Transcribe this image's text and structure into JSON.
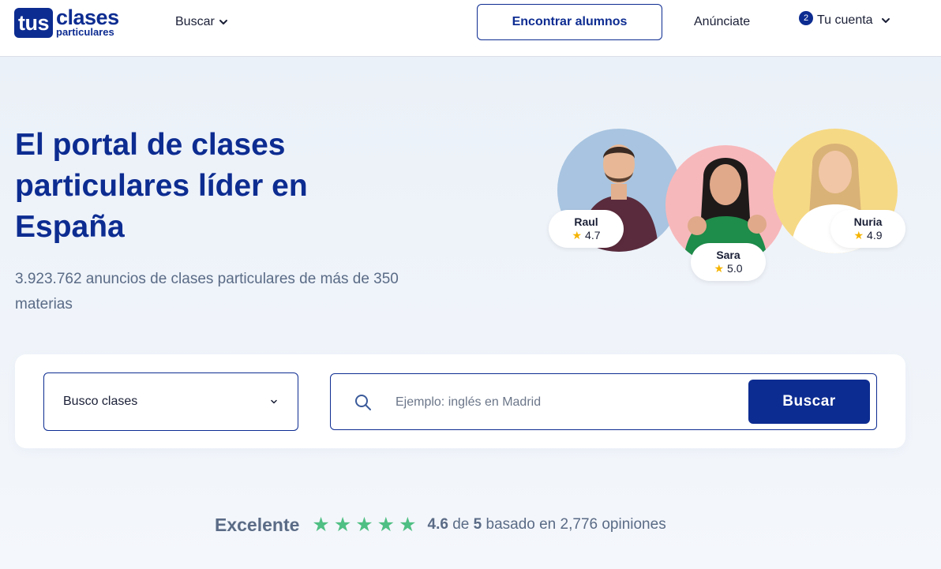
{
  "brand": {
    "logo_tus": "tus",
    "logo_clases": "clases",
    "logo_particulares": "particulares"
  },
  "nav": {
    "buscar_label": "Buscar",
    "encontrar_label": "Encontrar alumnos",
    "anunciate_label": "Anúnciate",
    "cuenta_badge": "2",
    "cuenta_label": "Tu cuenta"
  },
  "hero": {
    "title": "El portal de clases particulares líder en España",
    "subtitle": "3.923.762 anuncios de clases particulares de más de 350 materias"
  },
  "tutors": [
    {
      "name": "Raul",
      "rating": "4.7",
      "bg": "#a8c4e0"
    },
    {
      "name": "Sara",
      "rating": "5.0",
      "bg": "#f7b8bb"
    },
    {
      "name": "Nuria",
      "rating": "4.9",
      "bg": "#f6d985"
    }
  ],
  "search": {
    "select_value": "Busco clases",
    "placeholder": "Ejemplo: inglés en Madrid",
    "button_label": "Buscar"
  },
  "reviews": {
    "label": "Excelente",
    "stars": 5,
    "score": "4.6",
    "of": "de",
    "max": "5",
    "rest": "basado en 2,776 opiniones"
  },
  "colors": {
    "primary": "#0d2c91",
    "star_green": "#4fbf83",
    "star_gold": "#f5b400"
  }
}
